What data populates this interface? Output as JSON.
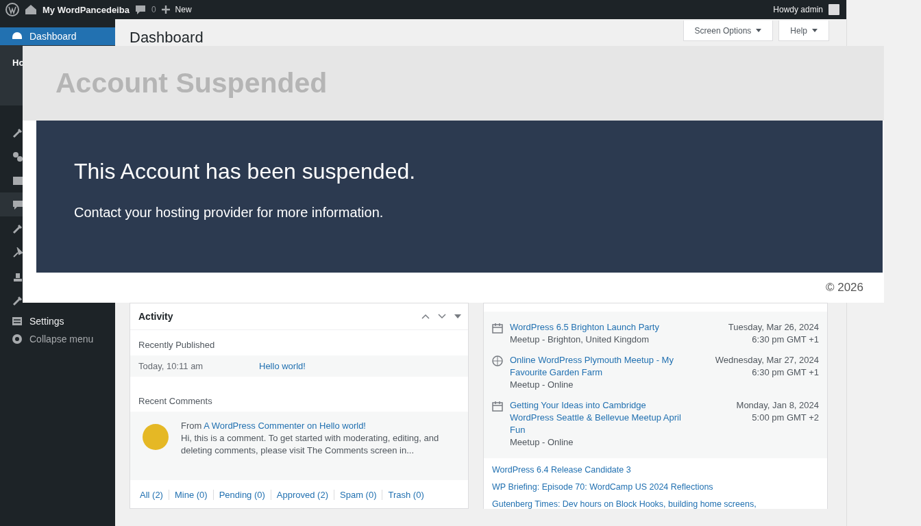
{
  "admin_bar": {
    "site_name": "My WordPancedeiba",
    "comments_count": "0",
    "new_label": "New",
    "account": "Howdy admin"
  },
  "sidebar": {
    "items": [
      {
        "label": "Dashboard",
        "selected": true
      },
      {
        "label": "Settings",
        "selected": false
      },
      {
        "label": "Collapse menu",
        "selected": false
      }
    ],
    "submenu_fragment": "Ho"
  },
  "header": {
    "title": "Dashboard",
    "buttons": [
      "Screen Options",
      "Help"
    ]
  },
  "notice": {
    "heading": "Account Suspended",
    "title": "This Account has been suspended.",
    "message": "Contact your hosting provider for more information.",
    "footer": "© 2026"
  },
  "activity": {
    "title": "Activity",
    "published_heading": "Recently Published",
    "published": [
      {
        "date": "Today, 10:11 am",
        "title": "Hello world!"
      }
    ],
    "comments_heading": "Recent Comments",
    "comments": [
      {
        "author": "From",
        "link": "A WordPress Commenter on Hello world!",
        "text": "Hi, this is a comment. To get started with moderating, editing, and deleting comments, please visit The Comments screen in..."
      }
    ],
    "filters": [
      "All (2)",
      "Mine (0)",
      "Pending (0)",
      "Approved (2)",
      "Spam (0)",
      "Trash (0)"
    ]
  },
  "events": {
    "items": [
      {
        "title": "WordPress 6.5 Brighton Launch Party",
        "place": "Meetup - Brighton, United Kingdom",
        "date": "Tuesday, Mar 26, 2024",
        "time": "6:30 pm GMT +1"
      },
      {
        "title": "Online WordPress Plymouth Meetup - My Favourite Garden Farm",
        "place": "Meetup - Online",
        "date": "Wednesday, Mar 27, 2024",
        "time": "6:30 pm GMT +1"
      },
      {
        "title": "Getting Your Ideas into Cambridge WordPress Seattle & Bellevue Meetup April Fun",
        "place": "Meetup - Online",
        "date": "Monday, Jan 8, 2024",
        "time": "5:00 pm GMT +2"
      }
    ],
    "news": [
      "WordPress 6.4 Release Candidate 3",
      "WP Briefing: Episode 70: WordCamp US 2024 Reflections",
      "Gutenberg Times: Dev hours on Block Hooks, building home screens,"
    ]
  }
}
